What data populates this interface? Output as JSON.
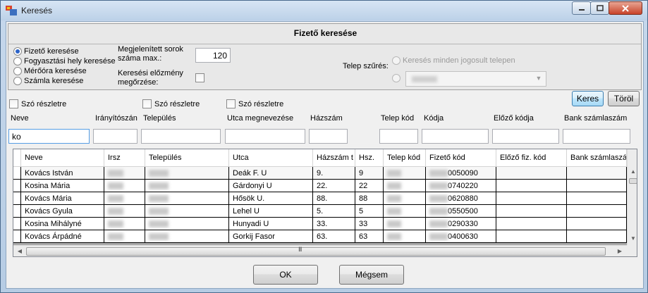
{
  "window": {
    "title": "Keresés"
  },
  "panel": {
    "heading": "Fizető keresése",
    "search_types": [
      {
        "label": "Fizető keresése",
        "checked": true
      },
      {
        "label": "Fogyasztási hely keresése",
        "checked": false
      },
      {
        "label": "Mérőóra keresése",
        "checked": false
      },
      {
        "label": "Számla keresése",
        "checked": false
      }
    ],
    "max_rows_label": "Megjelenített sorok száma max.:",
    "max_rows_value": "120",
    "history_label": "Keresési előzmény megőrzése:",
    "site_filter_label": "Telep szűrés:",
    "site_all_label": "Keresés minden jogosult telepen"
  },
  "filters": {
    "checkbox_label": "Szó részletre",
    "columns": [
      "Neve",
      "Irányítószán",
      "Település",
      "Utca megnevezése",
      "Házszám",
      "Telep kód",
      "Kódja",
      "Előző kódja",
      "Bank számlaszám"
    ],
    "name_value": "ko",
    "search_button": "Keres",
    "clear_button": "Töröl"
  },
  "grid": {
    "headers": [
      "Neve",
      "Irsz",
      "Település",
      "Utca",
      "Házszám t",
      "Hsz.",
      "Telep kód",
      "Fizető kód",
      "Előző fiz. kód",
      "Bank számlaszán"
    ],
    "rows": [
      {
        "name": "Kovács István",
        "street": "Deák F. U",
        "house": "9.",
        "hsz": "9",
        "code": "0050090"
      },
      {
        "name": "Kosina Mária",
        "street": "Gárdonyi U",
        "house": "22.",
        "hsz": "22",
        "code": "0740220"
      },
      {
        "name": "Kovács Mária",
        "street": "Hősök U.",
        "house": "88.",
        "hsz": "88",
        "code": "0620880"
      },
      {
        "name": "Kovács Gyula",
        "street": "Lehel U",
        "house": "5.",
        "hsz": "5",
        "code": "0550500"
      },
      {
        "name": "Kosina Mihályné",
        "street": "Hunyadi U",
        "house": "33.",
        "hsz": "33",
        "code": "0290330"
      },
      {
        "name": "Kovács Árpádné",
        "street": "Gorkij Fasor",
        "house": "63.",
        "hsz": "63",
        "code": "0400630"
      }
    ]
  },
  "buttons": {
    "ok": "OK",
    "cancel": "Mégsem"
  },
  "icons": {
    "scroll_grip": "III"
  }
}
